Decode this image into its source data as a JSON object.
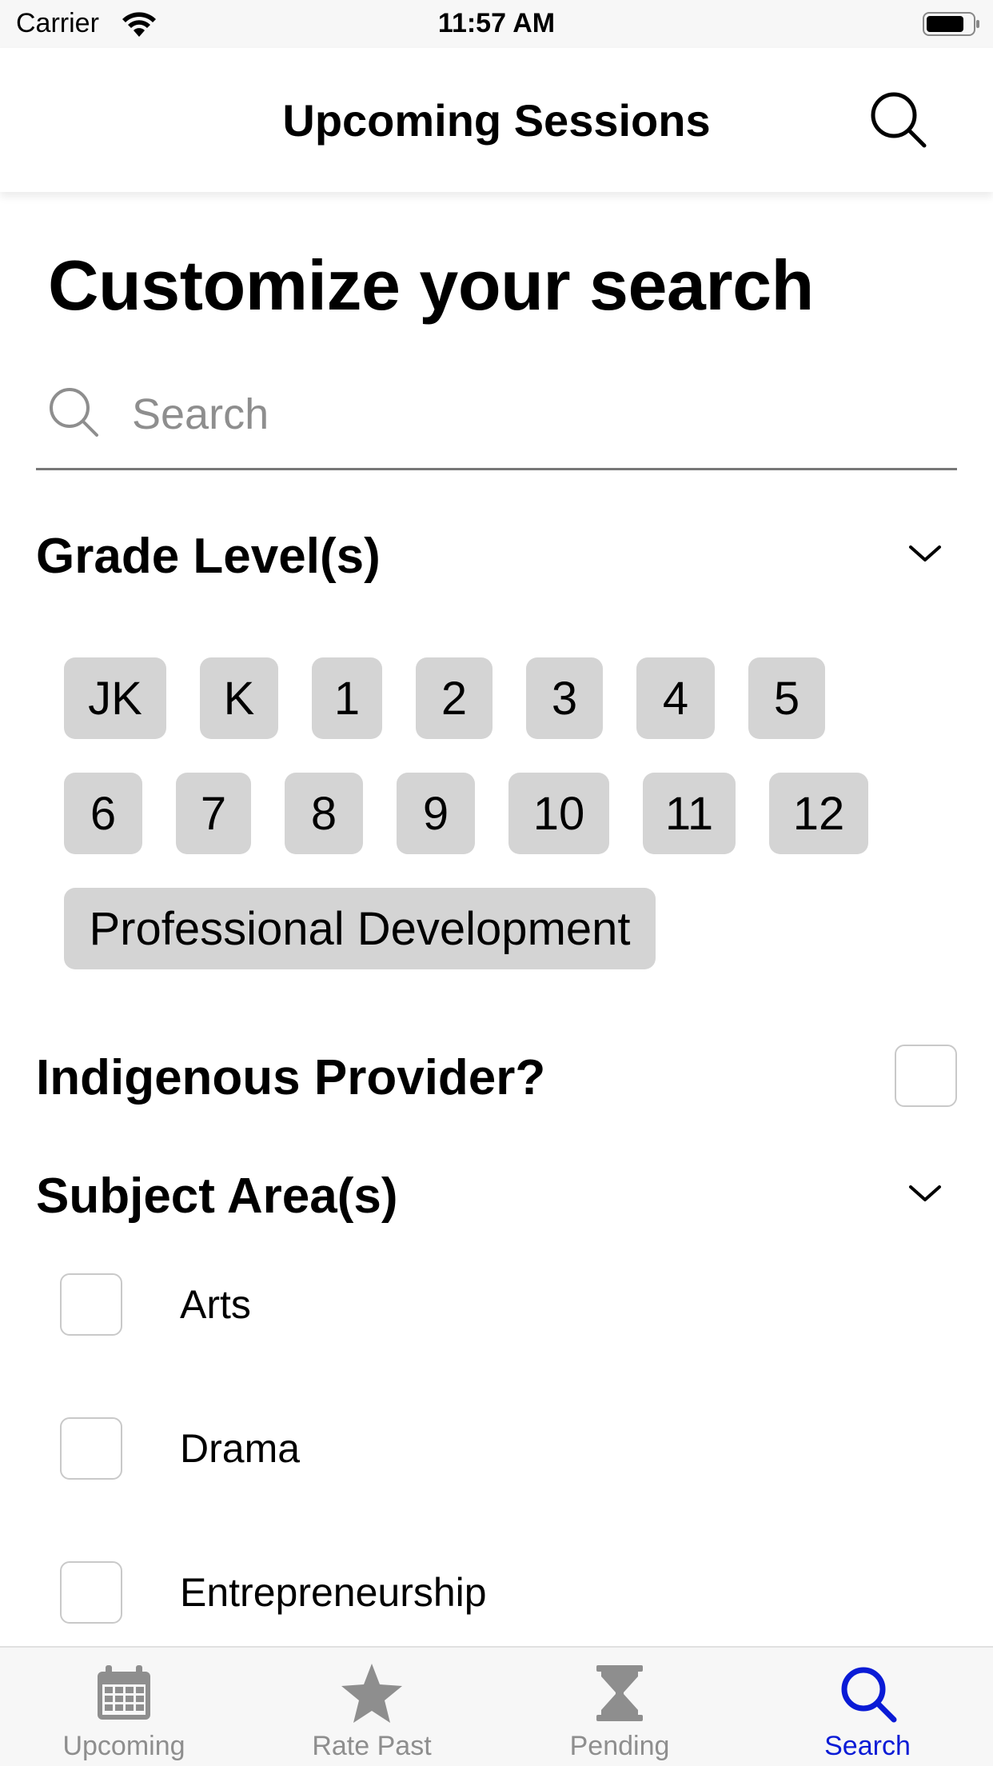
{
  "status_bar": {
    "carrier": "Carrier",
    "time": "11:57 AM"
  },
  "nav": {
    "title": "Upcoming Sessions"
  },
  "page": {
    "heading": "Customize your search"
  },
  "search": {
    "placeholder": "Search",
    "value": ""
  },
  "grade_section": {
    "title": "Grade Level(s)",
    "chips": [
      "JK",
      "K",
      "1",
      "2",
      "3",
      "4",
      "5",
      "6",
      "7",
      "8",
      "9",
      "10",
      "11",
      "12",
      "Professional Development"
    ]
  },
  "indigenous": {
    "label": "Indigenous Provider?",
    "checked": false
  },
  "subject_section": {
    "title": "Subject Area(s)",
    "items": [
      {
        "label": "Arts",
        "checked": false
      },
      {
        "label": "Drama",
        "checked": false
      },
      {
        "label": "Entrepreneurship",
        "checked": false
      }
    ]
  },
  "tabs": [
    {
      "label": "Upcoming",
      "icon": "calendar-icon",
      "active": false
    },
    {
      "label": "Rate Past",
      "icon": "star-icon",
      "active": false
    },
    {
      "label": "Pending",
      "icon": "hourglass-icon",
      "active": false
    },
    {
      "label": "Search",
      "icon": "search-icon",
      "active": true
    }
  ],
  "colors": {
    "accent": "#0a1bd6",
    "chip_bg": "#d4d4d4",
    "inactive_tab": "#8e8e8e"
  }
}
